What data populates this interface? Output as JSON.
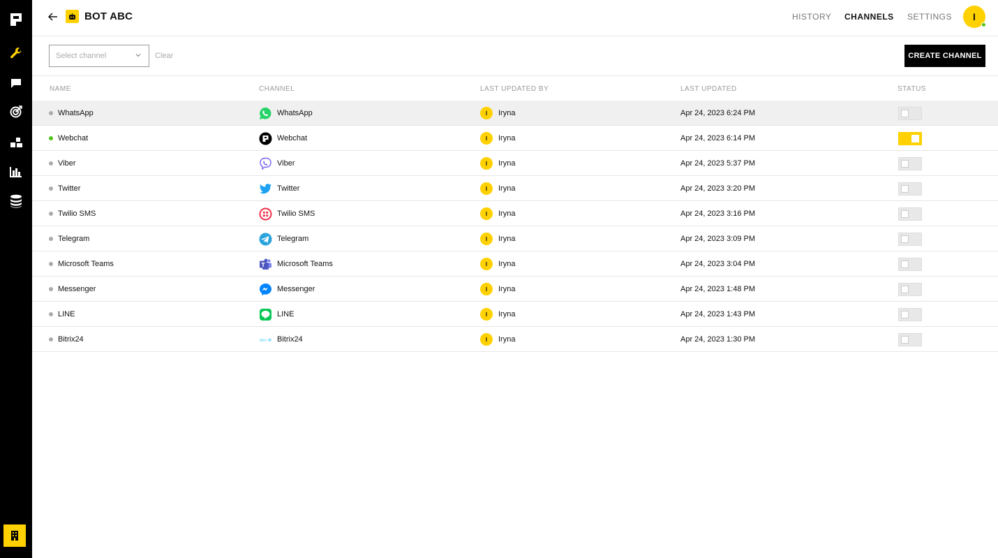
{
  "header": {
    "bot_name": "BOT ABC",
    "nav": [
      {
        "label": "HISTORY",
        "active": false
      },
      {
        "label": "CHANNELS",
        "active": true
      },
      {
        "label": "SETTINGS",
        "active": false
      }
    ],
    "user_initial": "I"
  },
  "sidebar": {
    "items": [
      "logo-icon",
      "wrench-icon",
      "chat-icon",
      "target-icon",
      "blocks-icon",
      "bar-chart-icon",
      "database-icon"
    ],
    "bottom_item": "building-icon"
  },
  "toolbar": {
    "select_placeholder": "Select channel",
    "clear_label": "Clear",
    "create_label": "CREATE CHANNEL"
  },
  "table": {
    "columns": [
      "NAME",
      "CHANNEL",
      "LAST UPDATED BY",
      "LAST UPDATED",
      "STATUS"
    ],
    "rows": [
      {
        "name": "WhatsApp",
        "channel": "WhatsApp",
        "icon": "whatsapp-icon",
        "user_initial": "I",
        "user": "Iryna",
        "updated": "Apr 24, 2023 6:24 PM",
        "active": false
      },
      {
        "name": "Webchat",
        "channel": "Webchat",
        "icon": "webchat-icon",
        "user_initial": "I",
        "user": "Iryna",
        "updated": "Apr 24, 2023 6:14 PM",
        "active": true
      },
      {
        "name": "Viber",
        "channel": "Viber",
        "icon": "viber-icon",
        "user_initial": "I",
        "user": "Iryna",
        "updated": "Apr 24, 2023 5:37 PM",
        "active": false
      },
      {
        "name": "Twitter",
        "channel": "Twitter",
        "icon": "twitter-icon",
        "user_initial": "I",
        "user": "Iryna",
        "updated": "Apr 24, 2023 3:20 PM",
        "active": false
      },
      {
        "name": "Twilio SMS",
        "channel": "Twilio SMS",
        "icon": "twilio-icon",
        "user_initial": "I",
        "user": "Iryna",
        "updated": "Apr 24, 2023 3:16 PM",
        "active": false
      },
      {
        "name": "Telegram",
        "channel": "Telegram",
        "icon": "telegram-icon",
        "user_initial": "I",
        "user": "Iryna",
        "updated": "Apr 24, 2023 3:09 PM",
        "active": false
      },
      {
        "name": "Microsoft Teams",
        "channel": "Microsoft Teams",
        "icon": "teams-icon",
        "user_initial": "I",
        "user": "Iryna",
        "updated": "Apr 24, 2023 3:04 PM",
        "active": false
      },
      {
        "name": "Messenger",
        "channel": "Messenger",
        "icon": "messenger-icon",
        "user_initial": "I",
        "user": "Iryna",
        "updated": "Apr 24, 2023 1:48 PM",
        "active": false
      },
      {
        "name": "LINE",
        "channel": "LINE",
        "icon": "line-icon",
        "user_initial": "I",
        "user": "Iryna",
        "updated": "Apr 24, 2023 1:43 PM",
        "active": false
      },
      {
        "name": "Bitrix24",
        "channel": "Bitrix24",
        "icon": "bitrix24-icon",
        "user_initial": "I",
        "user": "Iryna",
        "updated": "Apr 24, 2023 1:30 PM",
        "active": false
      }
    ]
  },
  "colors": {
    "accent": "#ffd100",
    "sidebar": "#000000",
    "online": "#52c41a"
  }
}
